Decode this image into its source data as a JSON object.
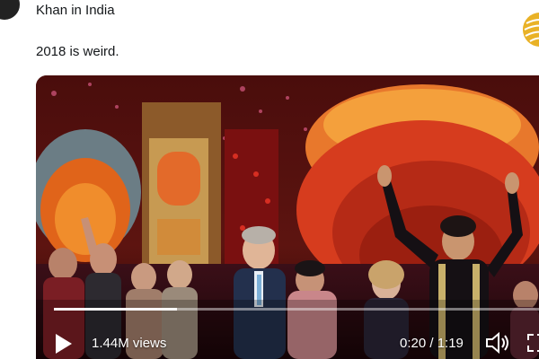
{
  "tweet": {
    "account_name": "Khan in India",
    "text": "2018 is weird."
  },
  "video": {
    "views": "1.44M views",
    "time": "0:20 / 1:19",
    "progress_fraction": 0.253,
    "icons": {
      "play": "play-icon",
      "volume": "volume-icon",
      "fullscreen": "fullscreen-icon"
    }
  },
  "colors": {
    "badge": "#e9b227",
    "text": "#14171a",
    "controls": "#ffffff"
  }
}
